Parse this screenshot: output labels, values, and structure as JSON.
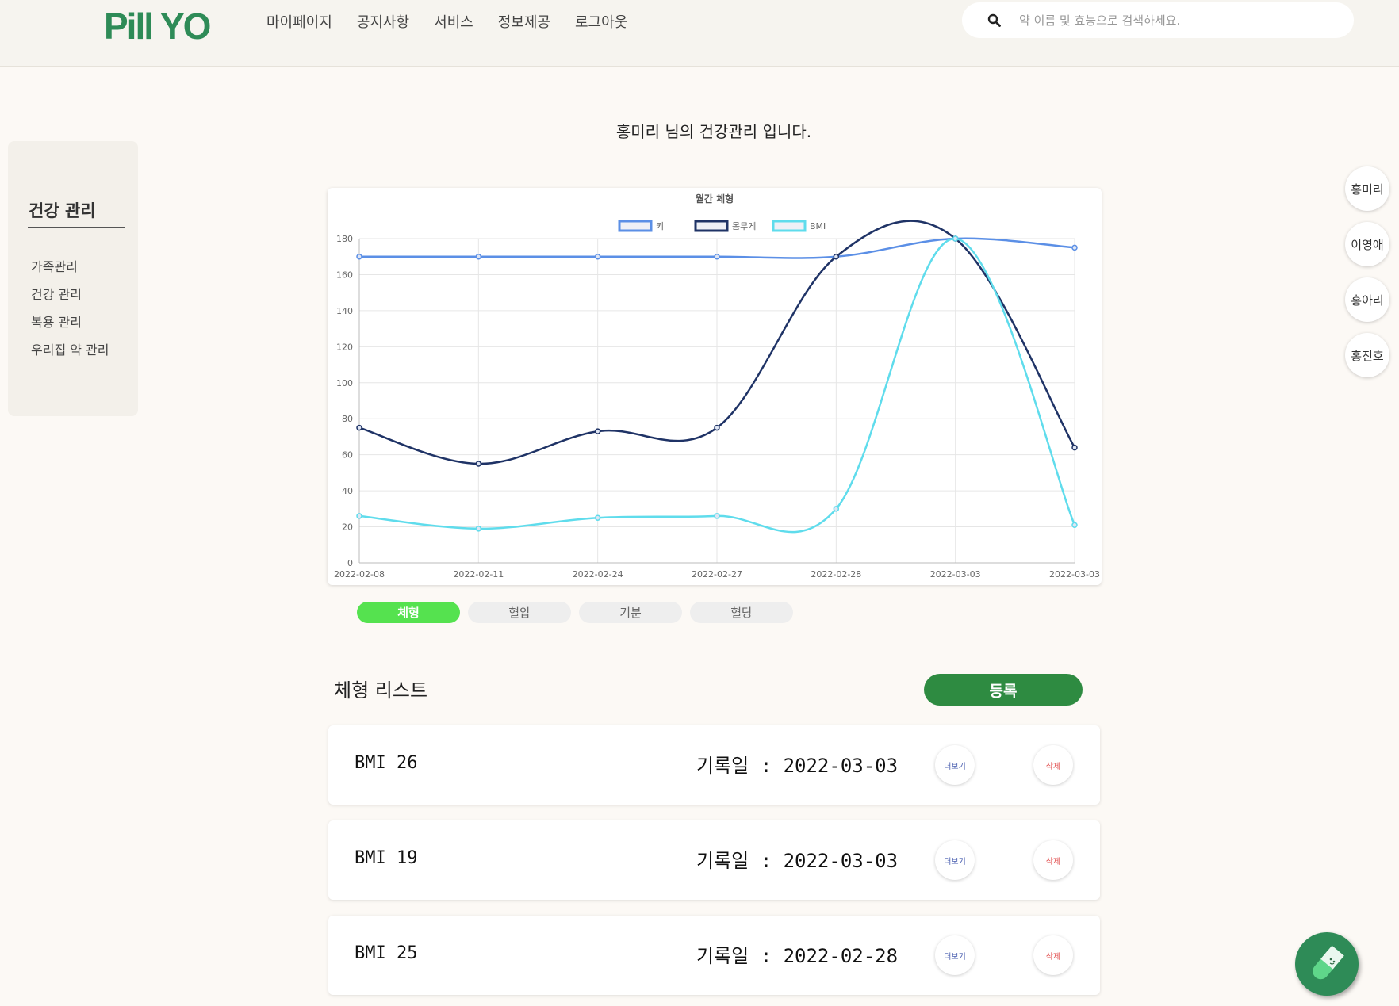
{
  "header": {
    "logo": "Pill YO",
    "nav": [
      "마이페이지",
      "공지사항",
      "서비스",
      "정보제공",
      "로그아웃"
    ],
    "search_placeholder": "약 이름 및 효능으로 검색하세요."
  },
  "sidebar": {
    "title": "건강 관리",
    "items": [
      "가족관리",
      "건강 관리",
      "복용 관리",
      "우리집 약 관리"
    ]
  },
  "page_title": "홍미리 님의 건강관리 입니다.",
  "chart_data": {
    "type": "line",
    "title": "월간 체형",
    "categories": [
      "2022-02-08",
      "2022-02-11",
      "2022-02-24",
      "2022-02-27",
      "2022-02-28",
      "2022-03-03",
      "2022-03-03"
    ],
    "series": [
      {
        "name": "키",
        "values": [
          170,
          170,
          170,
          170,
          170,
          180,
          175
        ],
        "color": "#5b8fe6"
      },
      {
        "name": "몸무게",
        "values": [
          75,
          55,
          73,
          75,
          170,
          180,
          64
        ],
        "color": "#1f3366"
      },
      {
        "name": "BMI",
        "values": [
          26,
          19,
          25,
          26,
          30,
          180,
          21
        ],
        "color": "#5fdcec"
      }
    ],
    "ylim": [
      0,
      180
    ],
    "yticks": [
      "0",
      "20",
      "40",
      "60",
      "80",
      "100",
      "120",
      "140",
      "160",
      "180"
    ],
    "grid": true,
    "legend_position": "top-center"
  },
  "tabs": [
    {
      "label": "체형",
      "active": true
    },
    {
      "label": "혈압",
      "active": false
    },
    {
      "label": "기분",
      "active": false
    },
    {
      "label": "혈당",
      "active": false
    }
  ],
  "list": {
    "title": "체형 리스트",
    "register_label": "등록",
    "rows": [
      {
        "bmi": "BMI 26",
        "date": "기록일 : 2022-03-03",
        "more": "더보기",
        "delete": "삭제"
      },
      {
        "bmi": "BMI 19",
        "date": "기록일 : 2022-03-03",
        "more": "더보기",
        "delete": "삭제"
      },
      {
        "bmi": "BMI 25",
        "date": "기록일 : 2022-02-28",
        "more": "더보기",
        "delete": "삭제"
      }
    ]
  },
  "family": [
    "홍미리",
    "이영애",
    "홍아리",
    "홍진호"
  ],
  "icons": {
    "search": "search-icon",
    "fab": "pill-icon"
  },
  "colors": {
    "brand": "#2e8b57",
    "active_tab": "#55e24f",
    "register": "#2e8b41"
  }
}
